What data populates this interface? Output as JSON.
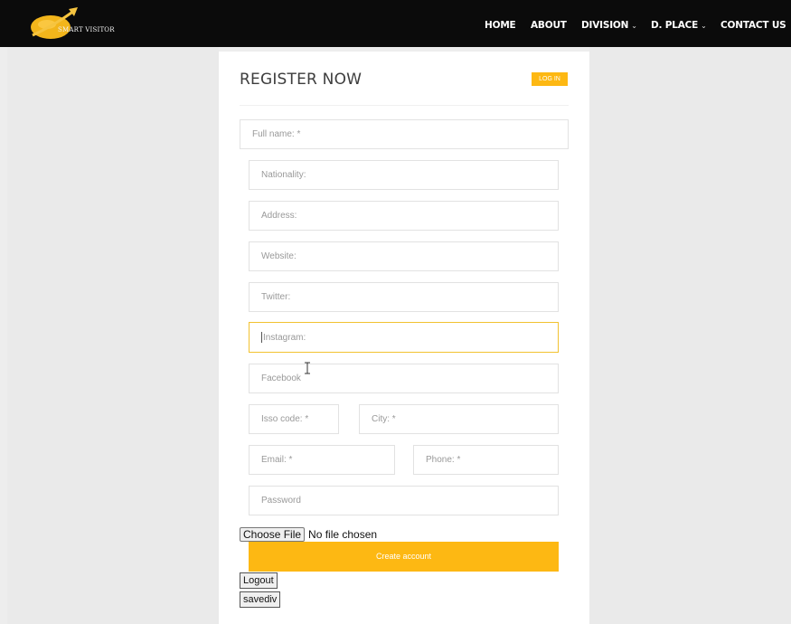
{
  "navbar": {
    "logo_text": "SMART VISITOR",
    "items": [
      {
        "label": "HOME",
        "has_dropdown": false
      },
      {
        "label": "ABOUT",
        "has_dropdown": false
      },
      {
        "label": "DIVISION",
        "has_dropdown": true
      },
      {
        "label": "D. PLACE",
        "has_dropdown": true
      },
      {
        "label": "CONTACT US",
        "has_dropdown": false
      }
    ],
    "dropdown_icon": "chevron-down-icon"
  },
  "form": {
    "title": "REGISTER NOW",
    "login_label": "LOG IN",
    "placeholders": {
      "full_name": "Full name: *",
      "nationality": "Nationality:",
      "address": "Address:",
      "website": "Website:",
      "twitter": "Twitter:",
      "instagram": "Instagram:",
      "facebook": "Facebook",
      "isso_code": "Isso code: *",
      "city": "City: *",
      "email": "Email: *",
      "phone": "Phone: *",
      "password": "Password"
    },
    "file": {
      "button_label": "Choose File",
      "status": "No file chosen"
    },
    "create_label": "Create account",
    "logout_label": "Logout",
    "savediv_label": "savediv"
  },
  "colors": {
    "accent": "#fdb813",
    "navbar": "#0b0b0b",
    "focus_border": "#f2c230"
  }
}
